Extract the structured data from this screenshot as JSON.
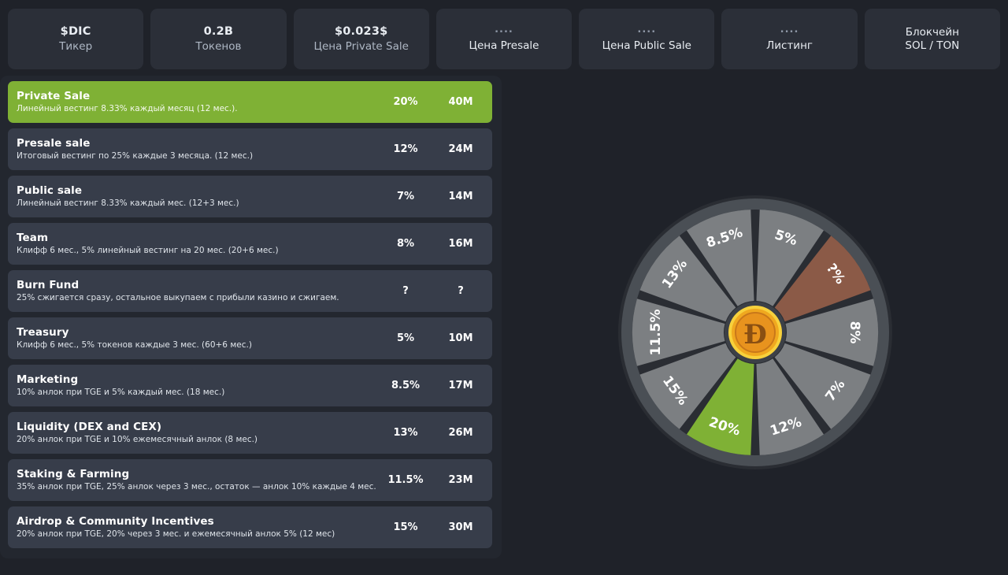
{
  "stats": [
    {
      "value": "$DIC",
      "label": "Тикер",
      "dots": false,
      "inverted": false
    },
    {
      "value": "0.2B",
      "label": "Токенов",
      "dots": false,
      "inverted": false
    },
    {
      "value": "$0.023$",
      "label": "Цена Private Sale",
      "dots": false,
      "inverted": false
    },
    {
      "value": "....",
      "label": "Цена Presale",
      "dots": true,
      "inverted": false
    },
    {
      "value": "....",
      "label": "Цена Public Sale",
      "dots": true,
      "inverted": false
    },
    {
      "value": "....",
      "label": "Листинг",
      "dots": true,
      "inverted": false
    },
    {
      "value": "Блокчейн",
      "label": "SOL / TON",
      "dots": false,
      "inverted": true
    }
  ],
  "allocations": [
    {
      "name": "Private Sale",
      "description": "Линейный вестинг 8.33% каждый месяц (12 мес.).",
      "percent": "20%",
      "amount": "40M",
      "highlight": true
    },
    {
      "name": "Presale sale",
      "description": "Итоговый вестинг по 25% каждые 3 месяца. (12 мес.)",
      "percent": "12%",
      "amount": "24M",
      "highlight": false
    },
    {
      "name": "Public sale",
      "description": "Линейный вестинг 8.33% каждый мес. (12+3 мес.)",
      "percent": "7%",
      "amount": "14M",
      "highlight": false
    },
    {
      "name": "Team",
      "description": "Клифф 6 мес., 5% линейный вестинг на 20 мес. (20+6 мес.)",
      "percent": "8%",
      "amount": "16M",
      "highlight": false
    },
    {
      "name": "Burn Fund",
      "description": "25% сжигается сразу, остальное выкупаем с прибыли казино и сжигаем.",
      "percent": "?",
      "amount": "?",
      "highlight": false
    },
    {
      "name": "Treasury",
      "description": "Клифф 6 мес., 5% токенов каждые 3 мес. (60+6 мес.)",
      "percent": "5%",
      "amount": "10M",
      "highlight": false
    },
    {
      "name": "Marketing",
      "description": "10% анлок при TGE и 5% каждый мес. (18 мес.)",
      "percent": "8.5%",
      "amount": "17M",
      "highlight": false
    },
    {
      "name": "Liquidity (DEX and CEX)",
      "description": "20% анлок при TGE и 10% ежемесячный анлок (8 мес.)",
      "percent": "13%",
      "amount": "26M",
      "highlight": false
    },
    {
      "name": "Staking & Farming",
      "description": "35% анлок при TGE, 25% анлок через 3 мес., остаток — анлок 10% каждые 4 мес.",
      "percent": "11.5%",
      "amount": "23M",
      "highlight": false
    },
    {
      "name": "Airdrop & Community Incentives",
      "description": "20% анлок при TGE, 20% через 3 мес. и ежемесячный анлок 5% (12 мес)",
      "percent": "15%",
      "amount": "30M",
      "highlight": false
    }
  ],
  "chart_data": {
    "type": "pie",
    "title": "",
    "note": "Wheel-of-fortune style chart: 10 equal-width segments, each labelled with its allocation share.",
    "center_icon": "dogecoin-coin-icon",
    "colors": {
      "highlight_green": "#7fb135",
      "highlight_brown": "#8b5a47",
      "segment_gray": "#7c7f82",
      "rim": "#4a4f55",
      "gap": "#2a2d33",
      "coin_outer": "#f3c53a",
      "coin_inner": "#e8931e"
    },
    "labels": [
      "8.5%",
      "5%",
      "?%",
      "8%",
      "7%",
      "12%",
      "20%",
      "15%",
      "11.5%",
      "13%"
    ],
    "values": [
      8.5,
      5,
      0,
      8,
      7,
      12,
      20,
      15,
      11.5,
      13
    ],
    "categories": [
      "Marketing",
      "Treasury",
      "Burn Fund",
      "Team",
      "Public sale",
      "Presale sale",
      "Private Sale",
      "Airdrop & Community Incentives",
      "Staking & Farming",
      "Liquidity (DEX and CEX)"
    ],
    "segment_colors": [
      "#7c7f82",
      "#7c7f82",
      "#8b5a47",
      "#7c7f82",
      "#7c7f82",
      "#7c7f82",
      "#7fb135",
      "#7c7f82",
      "#7c7f82",
      "#7c7f82"
    ],
    "legend_position": "none",
    "grid": false
  }
}
